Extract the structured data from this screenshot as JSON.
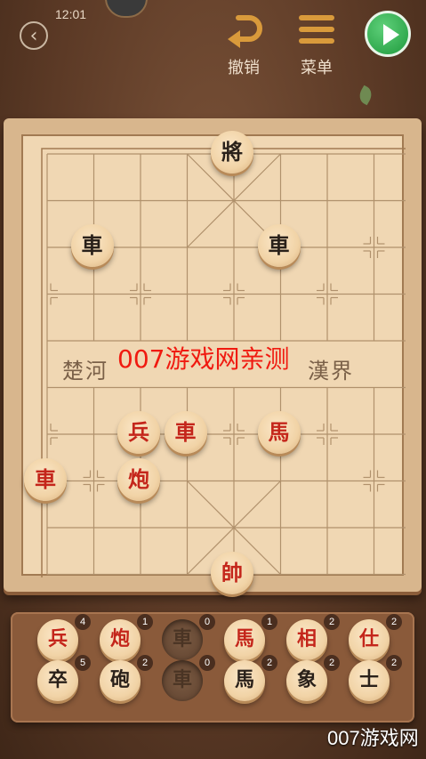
{
  "status": {
    "time": "12:01"
  },
  "toolbar": {
    "undo_label": "撤销",
    "menu_label": "菜单"
  },
  "board": {
    "river_left": "楚河",
    "river_right": "漢界"
  },
  "watermark": "007游戏网亲测",
  "site_mark": "007游戏网",
  "pieces_on_board": [
    {
      "char": "將",
      "side": "black",
      "col": 4,
      "row": 0
    },
    {
      "char": "車",
      "side": "black",
      "col": 1,
      "row": 2
    },
    {
      "char": "車",
      "side": "black",
      "col": 5,
      "row": 2
    },
    {
      "char": "兵",
      "side": "red",
      "col": 2,
      "row": 6
    },
    {
      "char": "車",
      "side": "red",
      "col": 3,
      "row": 6
    },
    {
      "char": "馬",
      "side": "red",
      "col": 5,
      "row": 6
    },
    {
      "char": "車",
      "side": "red",
      "col": 0,
      "row": 7
    },
    {
      "char": "炮",
      "side": "red",
      "col": 2,
      "row": 7
    },
    {
      "char": "帥",
      "side": "red",
      "col": 4,
      "row": 9
    }
  ],
  "captured_tray": {
    "top_row": [
      {
        "char": "兵",
        "side": "red",
        "count": "4"
      },
      {
        "char": "炮",
        "side": "red",
        "count": "1"
      },
      {
        "char": "車",
        "side": "ghost",
        "count": "0"
      },
      {
        "char": "馬",
        "side": "red",
        "count": "1"
      },
      {
        "char": "相",
        "side": "red",
        "count": "2"
      },
      {
        "char": "仕",
        "side": "red",
        "count": "2"
      }
    ],
    "bottom_row": [
      {
        "char": "卒",
        "side": "black",
        "count": "5"
      },
      {
        "char": "砲",
        "side": "black",
        "count": "2"
      },
      {
        "char": "車",
        "side": "ghost",
        "count": "0"
      },
      {
        "char": "馬",
        "side": "black",
        "count": "2"
      },
      {
        "char": "象",
        "side": "black",
        "count": "2"
      },
      {
        "char": "士",
        "side": "black",
        "count": "2"
      }
    ]
  }
}
